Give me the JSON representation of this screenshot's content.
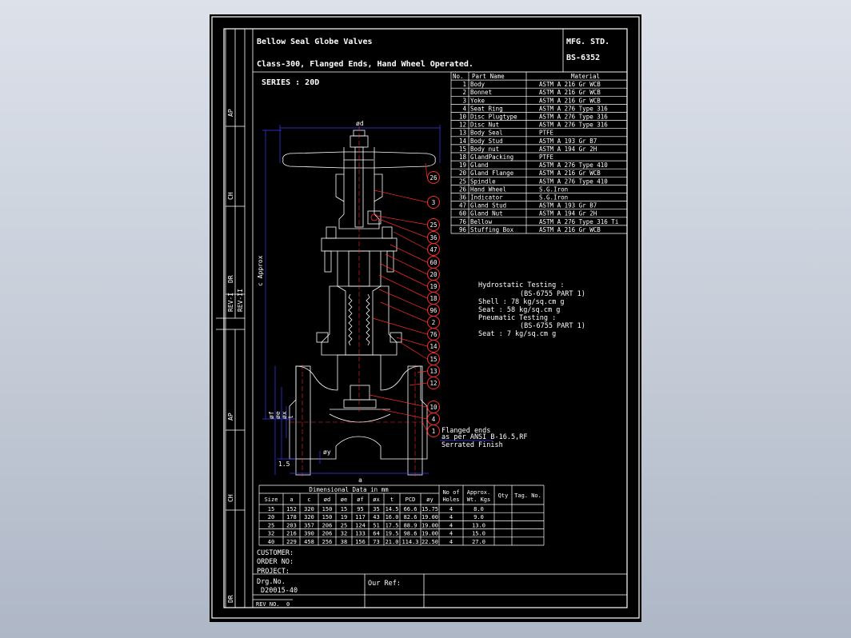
{
  "title": {
    "line1": "Bellow Seal Globe Valves",
    "line2": "Class-300, Flanged Ends, Hand Wheel Operated.",
    "mfg_label": "MFG. STD.",
    "mfg_value": "BS-6352",
    "series": "SERIES : 20D"
  },
  "parts": {
    "headers": [
      "No.",
      "Part Name",
      "Material"
    ],
    "rows": [
      [
        "1",
        "Body",
        "ASTM A 216 Gr WCB"
      ],
      [
        "2",
        "Bonnet",
        "ASTM A 216 Gr WCB"
      ],
      [
        "3",
        "Yoke",
        "ASTM A 216 Gr WCB"
      ],
      [
        "4",
        "Seat Ring",
        "ASTM A 276 Type 316"
      ],
      [
        "10",
        "Disc Plugtype",
        "ASTM A 276 Type 316"
      ],
      [
        "12",
        "Disc Nut",
        "ASTM A 276 Type 316"
      ],
      [
        "13",
        "Body Seal",
        "PTFE"
      ],
      [
        "14",
        "Body Stud",
        "ASTM A 193 Gr B7"
      ],
      [
        "15",
        "Body nut",
        "ASTM A 194 Gr 2H"
      ],
      [
        "18",
        "GlandPacking",
        "PTFE"
      ],
      [
        "19",
        "Gland",
        "ASTM A 276 Type 410"
      ],
      [
        "20",
        "Gland Flange",
        "ASTM A 216 Gr WCB"
      ],
      [
        "25",
        "Spindle",
        "ASTM A 276 Type 410"
      ],
      [
        "26",
        "Hand Wheel",
        "S.G.Iron"
      ],
      [
        "36",
        "Indicator",
        "S.G.Iron"
      ],
      [
        "47",
        "Gland Stud",
        "ASTM A 193 Gr B7"
      ],
      [
        "60",
        "Gland Nut",
        "ASTM A 194 Gr 2H"
      ],
      [
        "76",
        "Bellow",
        "ASTM A 276 Type 316 Ti"
      ],
      [
        "96",
        "Stuffing Box",
        "ASTM A 216 Gr WCB"
      ]
    ]
  },
  "testing": {
    "hydro": "Hydrostatic Testing :",
    "hydro_std": "(BS-6755 PART 1)",
    "shell": "Shell : 78 kg/sq.cm g",
    "seat": "Seat  : 58 kg/sq.cm g",
    "pneu": "Pneumatic Testing :",
    "pneu_std": "(BS-6755 PART 1)",
    "pneu_seat": "Seat : 7 kg/sq.cm g"
  },
  "drawing": {
    "dim_d": "ød",
    "dim_c": "c Approx",
    "dim_a": "a",
    "dim_15": "1.5",
    "dim_y": "øy",
    "dim_f": "øf",
    "dim_e": "øe",
    "dim_x": "øx",
    "dim_t": "t",
    "callouts": [
      "26",
      "3",
      "25",
      "36",
      "47",
      "60",
      "20",
      "19",
      "18",
      "96",
      "2",
      "76",
      "14",
      "15",
      "13",
      "12",
      "10",
      "4",
      "1"
    ],
    "flange_note": [
      "Flanged ends",
      "as per ANSI B-16.5,RF",
      "Serrated Finish"
    ]
  },
  "dimensions": {
    "caption": "Dimensional Data in mm",
    "headers": [
      "Size",
      "a",
      "c",
      "ød",
      "øe",
      "øf",
      "øx",
      "t",
      "PCD",
      "øy"
    ],
    "extra_headers": [
      "No of Holes",
      "Approx. Wt. Kgs",
      "Qty",
      "Tag. No."
    ],
    "rows": [
      [
        "15",
        "152",
        "320",
        "150",
        "15",
        "95",
        "35",
        "14.5",
        "66.6",
        "15.75",
        "4",
        "8.0"
      ],
      [
        "20",
        "178",
        "320",
        "150",
        "19",
        "117",
        "43",
        "16.0",
        "82.6",
        "19.00",
        "4",
        "9.0"
      ],
      [
        "25",
        "203",
        "357",
        "206",
        "25",
        "124",
        "51",
        "17.5",
        "88.9",
        "19.00",
        "4",
        "13.0"
      ],
      [
        "32",
        "216",
        "390",
        "206",
        "32",
        "133",
        "64",
        "19.5",
        "98.6",
        "19.00",
        "4",
        "15.0"
      ],
      [
        "40",
        "229",
        "458",
        "256",
        "38",
        "156",
        "73",
        "21.0",
        "114.3",
        "22.50",
        "4",
        "27.0"
      ]
    ]
  },
  "footer": {
    "customer": "CUSTOMER:",
    "order": "ORDER NO:",
    "project": "PROJECT:",
    "drg_label": "Drg.No.",
    "drg_value": "D20015-40",
    "our_ref": "Our Ref:",
    "rev": "REV NO.",
    "rev_value": "0"
  },
  "side_labels": [
    "AP",
    "CH",
    "DR",
    "REV-I",
    "REV-II",
    "AP",
    "CH",
    "DR"
  ],
  "colors": {
    "background": "#c7ced9",
    "sheet": "#000000",
    "line": "#ffffff",
    "dimension": "#3a3aff",
    "leader": "#ff1a1a"
  }
}
